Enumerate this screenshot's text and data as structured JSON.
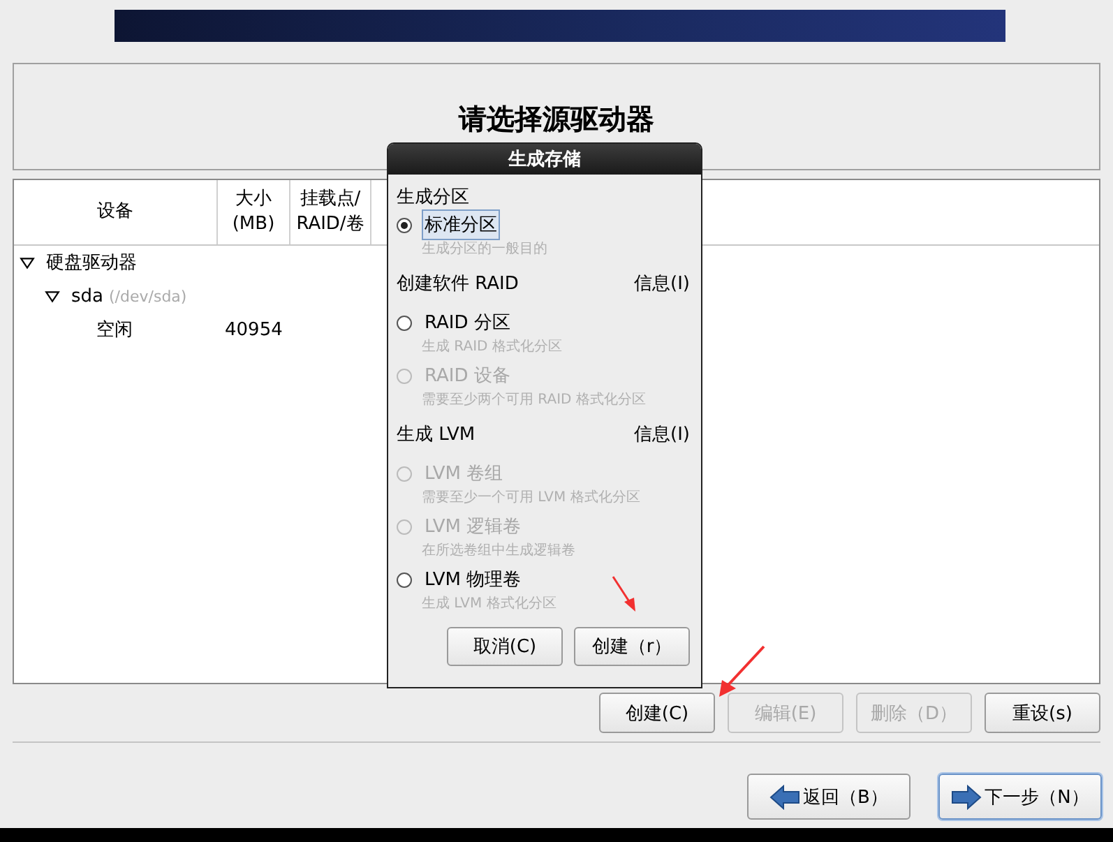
{
  "title": "请选择源驱动器",
  "table": {
    "columns": [
      "设备",
      "大小\n(MB)",
      "挂载点/\nRAID/卷"
    ],
    "tree": [
      {
        "name": "硬盘驱动器",
        "expanded": true,
        "children": [
          {
            "name": "sda",
            "path": "(/dev/sda)",
            "expanded": true,
            "children": [
              {
                "name": "空闲",
                "size": "40954"
              }
            ]
          }
        ]
      }
    ]
  },
  "dialog": {
    "title": "生成存储",
    "sections": [
      {
        "heading": "生成分区",
        "options": [
          {
            "label": "标准分区",
            "description": "生成分区的一般目的",
            "selected": true,
            "disabled": false
          }
        ]
      },
      {
        "heading": "创建软件 RAID",
        "info": "信息(I)",
        "options": [
          {
            "label": "RAID 分区",
            "description": "生成 RAID 格式化分区",
            "selected": false,
            "disabled": false
          },
          {
            "label": "RAID 设备",
            "description": "需要至少两个可用 RAID 格式化分区",
            "selected": false,
            "disabled": true
          }
        ]
      },
      {
        "heading": "生成 LVM",
        "info": "信息(I)",
        "options": [
          {
            "label": "LVM 卷组",
            "description": "需要至少一个可用 LVM 格式化分区",
            "selected": false,
            "disabled": true
          },
          {
            "label": "LVM 逻辑卷",
            "description": "在所选卷组中生成逻辑卷",
            "selected": false,
            "disabled": true
          },
          {
            "label": "LVM 物理卷",
            "description": "生成 LVM 格式化分区",
            "selected": false,
            "disabled": false
          }
        ]
      }
    ],
    "buttons": [
      "取消(C)",
      "创建（r）"
    ]
  },
  "actions": [
    {
      "label": "创建(C)",
      "disabled": false
    },
    {
      "label": "编辑(E)",
      "disabled": true
    },
    {
      "label": "删除（D）",
      "disabled": true
    },
    {
      "label": "重设(s)",
      "disabled": false
    }
  ],
  "nav": [
    {
      "label": "返回（B）",
      "kind": "back",
      "focused": false
    },
    {
      "label": "下一步（N）",
      "kind": "next",
      "focused": true
    }
  ]
}
